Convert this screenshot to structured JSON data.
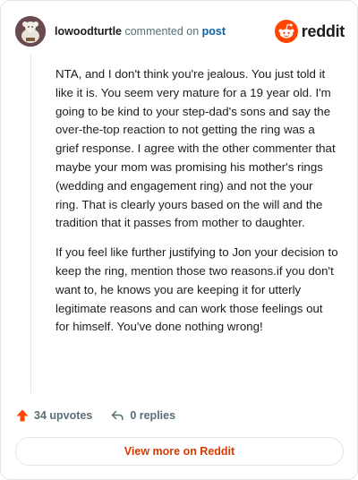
{
  "header": {
    "username": "lowoodturtle",
    "action_text": "commented on",
    "post_link": "post",
    "brand": "reddit"
  },
  "comment": {
    "paragraphs": [
      "NTA, and I don't think you're jealous. You just told it like it is. You seem very mature for a 19 year old. I'm going to be kind to your step-dad's sons and say the over-the-top reaction to not getting the ring was a grief response. I agree with the other commenter that maybe your mom was promising his mother's rings (wedding and engagement ring) and not the your ring. That is clearly yours based on the will and the tradition that it passes from mother to daughter.",
      "If you feel like further justifying to Jon your decision to keep the ring, mention those two reasons.if you don't want to, he knows you are keeping it for utterly legitimate reasons and can work those feelings out for himself. You've done nothing wrong!"
    ]
  },
  "footer": {
    "upvotes": "34 upvotes",
    "replies": "0 replies"
  },
  "view_more_label": "View more on Reddit",
  "colors": {
    "brand_orange": "#ff4500",
    "link_blue": "#0b63a6",
    "cta_text": "#d93a00",
    "muted": "#576f76"
  },
  "icons": [
    "avatar",
    "reddit-logo-icon",
    "upvote-arrow-icon",
    "reply-icon"
  ]
}
